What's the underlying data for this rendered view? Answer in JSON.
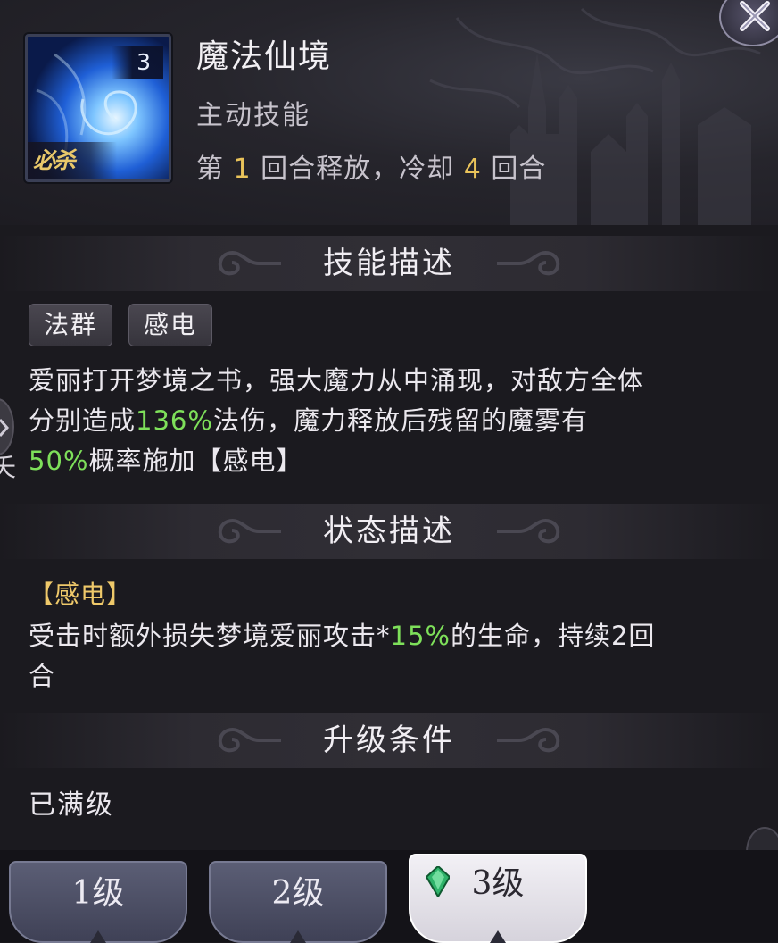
{
  "skill": {
    "name": "魔法仙境",
    "type": "主动技能",
    "cooldown": {
      "prefix": "第 ",
      "first_round": "1",
      "middle": " 回合释放，冷却 ",
      "cooldown_rounds": "4",
      "suffix": " 回合"
    },
    "icon": {
      "level": "3",
      "ultimate_label": "必杀"
    }
  },
  "sections": {
    "skill_description": {
      "title": "技能描述",
      "tags": [
        "法群",
        "感电"
      ],
      "text": {
        "part1": "爱丽打开梦境之书，强大魔力从中涌现，对敌方全体",
        "part2": "分别造成",
        "damage": "136%",
        "part3": "法伤，魔力释放后残留的魔雾有",
        "chance": "50%",
        "part4": "概率施加【感电】"
      }
    },
    "status_description": {
      "title": "状态描述",
      "status_name": "【感电】",
      "text": {
        "part1": "受击时额外损失梦境爱丽攻击*",
        "percent": "15%",
        "part2": "的生命，持续2回",
        "part3": "合"
      }
    },
    "upgrade": {
      "title": "升级条件",
      "text": "已满级"
    }
  },
  "side": {
    "char": "夭"
  },
  "tabs": [
    {
      "label": "1级",
      "active": false
    },
    {
      "label": "2级",
      "active": false
    },
    {
      "label": "3级",
      "active": true
    }
  ],
  "colors": {
    "highlight_green": "#7ee05a",
    "highlight_gold": "#e9c35a",
    "background": "#1b1a1f"
  },
  "icons": [
    "close-icon",
    "gem-icon",
    "chevron-right-icon"
  ]
}
